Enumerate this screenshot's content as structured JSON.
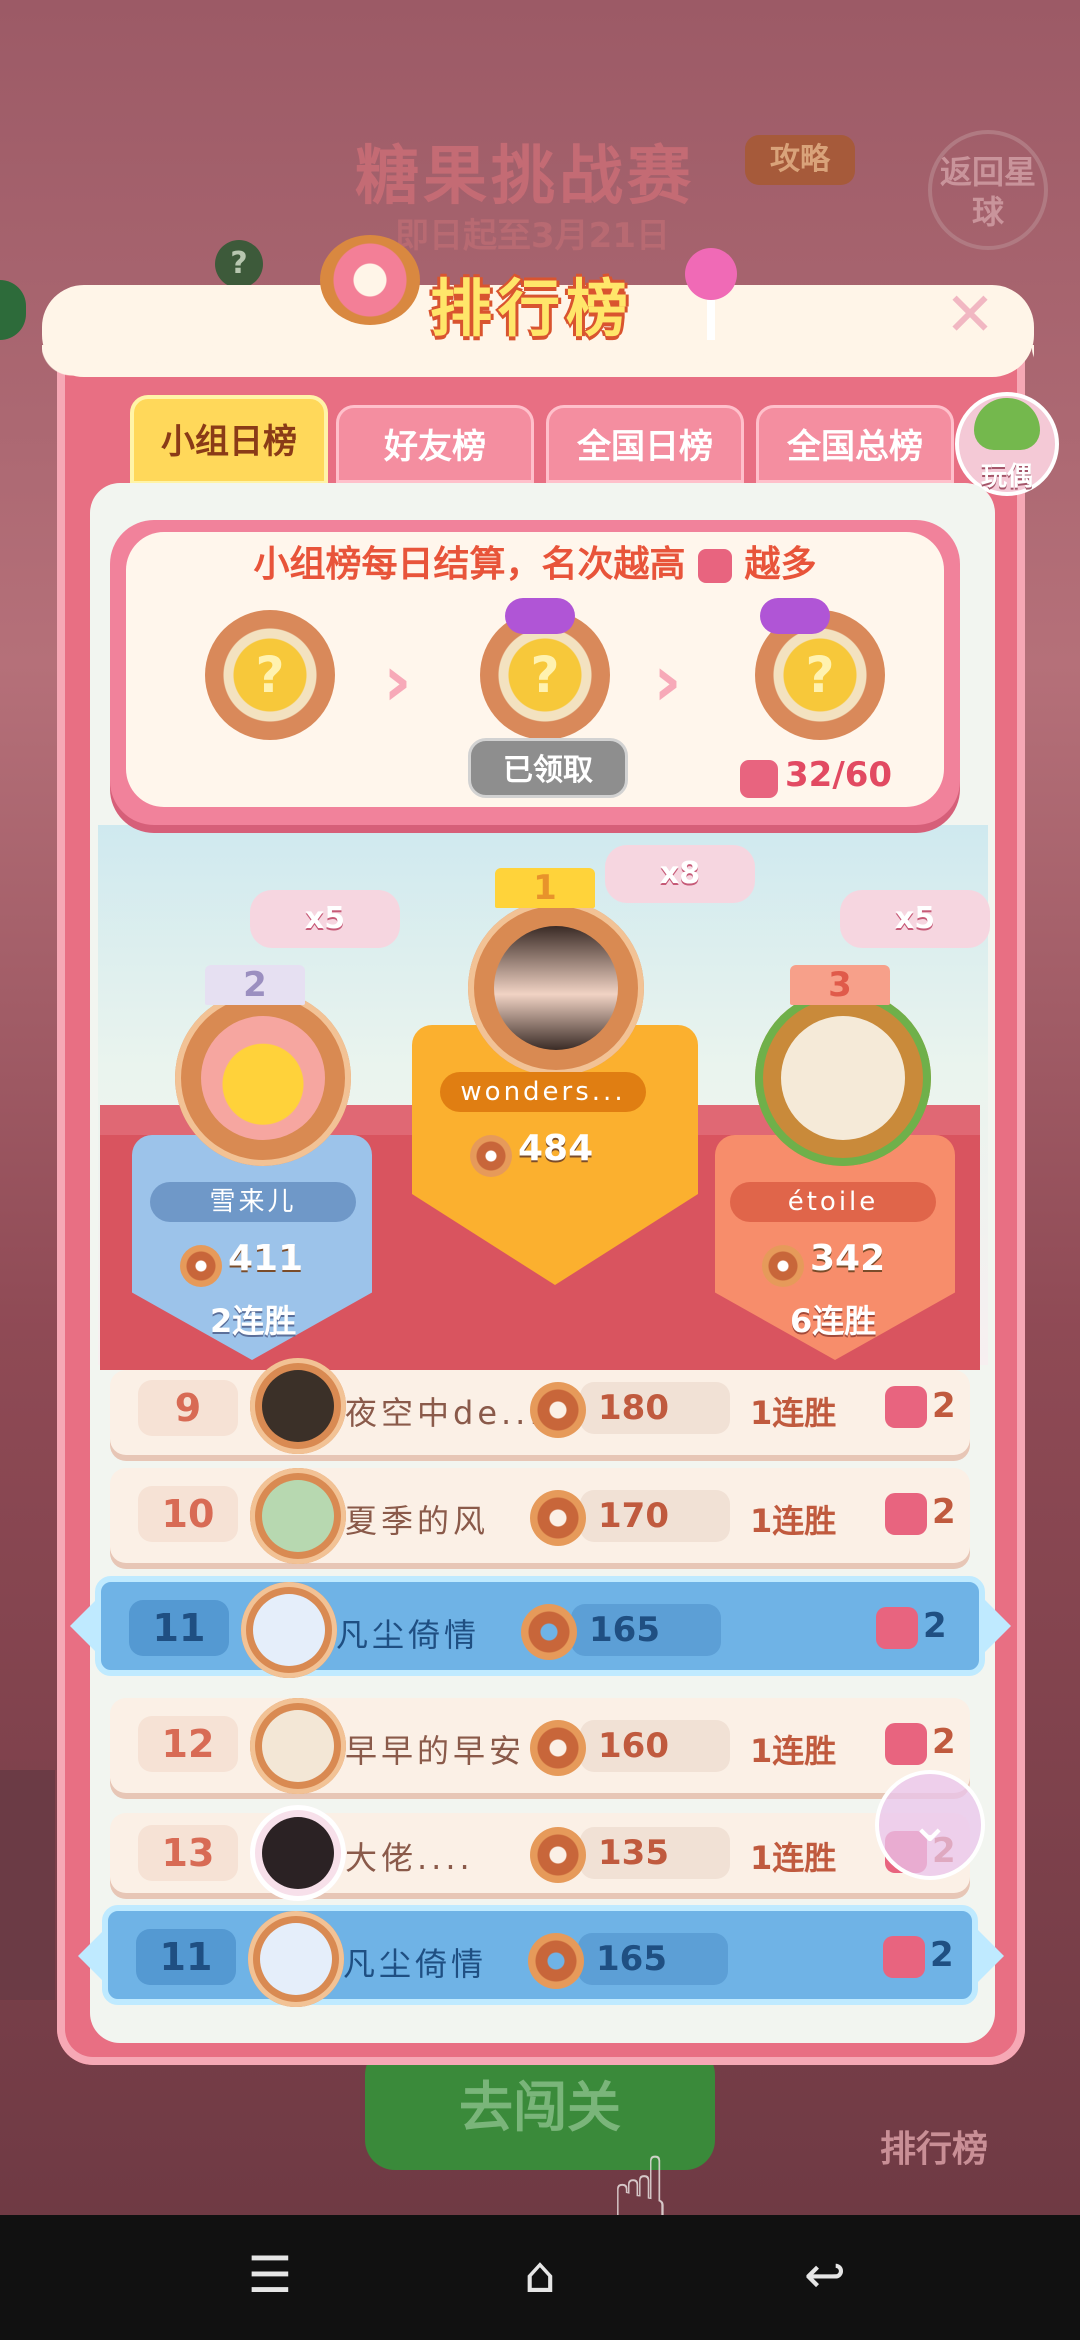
{
  "background": {
    "title": "糖果挑战赛",
    "subtitle": "即日起至3月21日",
    "guide_label": "攻略",
    "back_label": "返回星球",
    "go_label": "去闯关",
    "rank_label": "排行榜"
  },
  "panel": {
    "title": "排行榜",
    "tabs": [
      {
        "label": "小组日榜",
        "active": true
      },
      {
        "label": "好友榜",
        "active": false
      },
      {
        "label": "全国日榜",
        "active": false
      },
      {
        "label": "全国总榜",
        "active": false
      }
    ],
    "doll_label": "玩偶"
  },
  "reward": {
    "text_before": "小组榜每日结算，名次越高",
    "text_after": "越多",
    "claimed_label": "已领取",
    "progress": "32/60"
  },
  "podium": {
    "first": {
      "name": "wonders...",
      "score": "484",
      "bonus": "x8",
      "crown": "1"
    },
    "second": {
      "name": "雪来儿",
      "score": "411",
      "streak": "2连胜",
      "bonus": "x5",
      "crown": "2"
    },
    "third": {
      "name": "étoile",
      "score": "342",
      "streak": "6连胜",
      "bonus": "x5",
      "crown": "3"
    }
  },
  "rows": [
    {
      "rank": "9",
      "name": "夜空中de...",
      "score": "180",
      "streak": "1连胜",
      "reward": "2"
    },
    {
      "rank": "10",
      "name": "夏季的风",
      "score": "170",
      "streak": "1连胜",
      "reward": "2"
    },
    {
      "rank": "11",
      "name": "凡尘倚情",
      "score": "165",
      "streak": "",
      "reward": "2",
      "me": true
    },
    {
      "rank": "12",
      "name": "早早的早安",
      "score": "160",
      "streak": "1连胜",
      "reward": "2"
    },
    {
      "rank": "13",
      "name": "大佬....",
      "score": "135",
      "streak": "1连胜",
      "reward": "2"
    }
  ],
  "my_row": {
    "rank": "11",
    "name": "凡尘倚情",
    "score": "165",
    "reward": "2"
  },
  "colors": {
    "panel": "#e86f83",
    "active_tab": "#ffd85a",
    "me_row": "#6fb3e6",
    "first_place": "#fbb02f"
  },
  "icons": {
    "close": "close-icon",
    "scroll": "chevron-down-icon",
    "nav": [
      "menu-icon",
      "home-icon",
      "back-icon"
    ]
  }
}
